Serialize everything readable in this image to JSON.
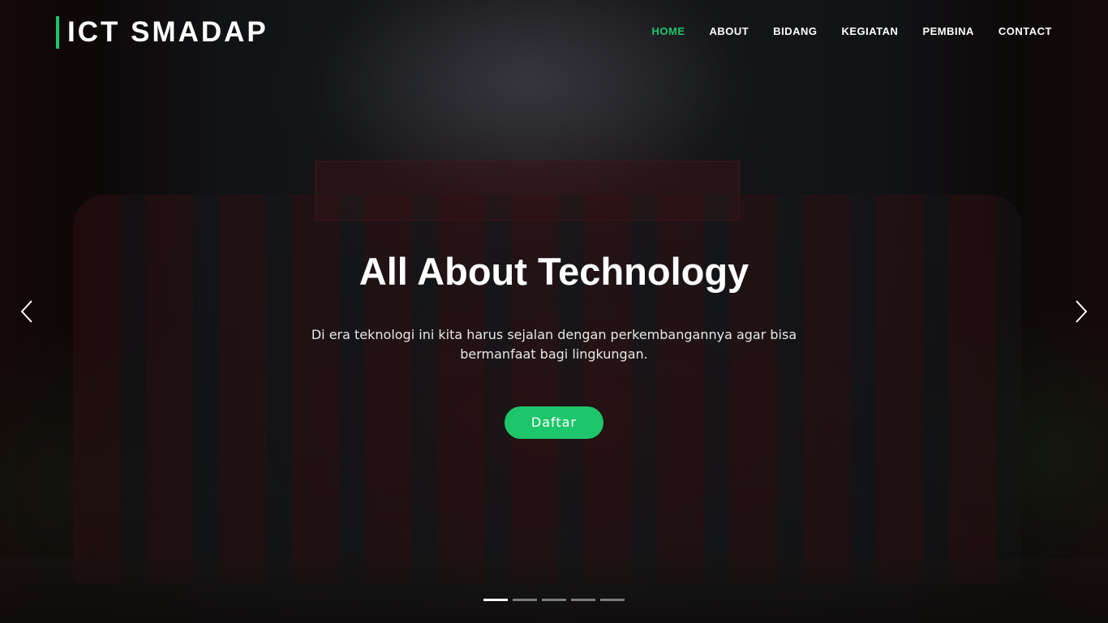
{
  "brand": {
    "name": "ICT SMADAP",
    "accent_color": "#1ec66b"
  },
  "nav": {
    "items": [
      {
        "label": "HOME",
        "active": true
      },
      {
        "label": "ABOUT",
        "active": false
      },
      {
        "label": "BIDANG",
        "active": false
      },
      {
        "label": "KEGIATAN",
        "active": false
      },
      {
        "label": "PEMBINA",
        "active": false
      },
      {
        "label": "CONTACT",
        "active": false
      }
    ]
  },
  "hero": {
    "title": "All About Technology",
    "description": "Di era teknologi ini kita harus sejalan dengan perkembangannya agar bisa bermanfaat bagi lingkungan.",
    "cta_label": "Daftar",
    "background_icon": "group-photo-image"
  },
  "carousel": {
    "prev_icon": "chevron-left-icon",
    "next_icon": "chevron-right-icon",
    "slide_count": 5,
    "active_index": 0
  }
}
